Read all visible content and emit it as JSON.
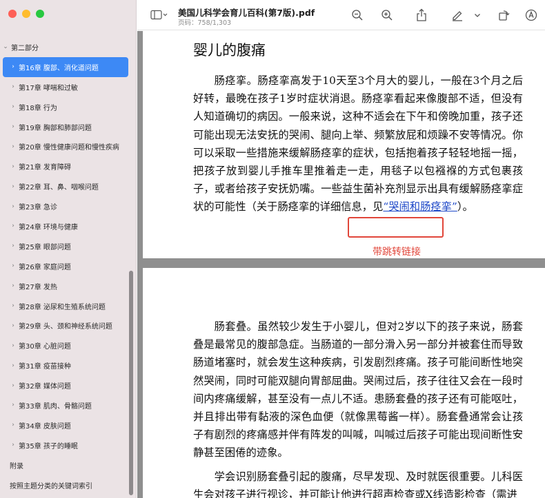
{
  "window": {
    "doc_title": "美国儿科学会育儿百科(第7版).pdf",
    "page_info": "页码：758/1,303"
  },
  "toolbar": {
    "icons": [
      "sidebar-toggle-icon",
      "chevron-down-icon",
      "zoom-out-icon",
      "zoom-in-icon",
      "share-icon",
      "highlight-pen-icon",
      "chevron-down-icon",
      "rotate-icon",
      "markup-icon"
    ]
  },
  "sidebar": {
    "section": "第二部分",
    "chapters": [
      "第16章 腹部、消化道问题",
      "第17章 哮喘和过敏",
      "第18章 行为",
      "第19章 胸部和肺部问题",
      "第20章 慢性健康问题和慢性疾病",
      "第21章 发育障碍",
      "第22章 耳、鼻、咽喉问题",
      "第23章 急诊",
      "第24章 环境与健康",
      "第25章 眼部问题",
      "第26章 家庭问题",
      "第27章 发热",
      "第28章 泌尿和生殖系统问题",
      "第29章 头、颈和神经系统问题",
      "第30章 心脏问题",
      "第31章 疫苗接种",
      "第32章 媒体问题",
      "第33章 肌肉、骨骼问题",
      "第34章 皮肤问题",
      "第35章 孩子的睡眠"
    ],
    "appendix": "附录",
    "index": "按照主题分类的关键词索引"
  },
  "page1": {
    "heading": "婴儿的腹痛",
    "para_before_link": "肠痉挛。肠痉挛高发于10天至3个月大的婴儿，一般在3个月之后好转，最晚在孩子1岁时症状消退。肠痉挛看起来像腹部不适，但没有人知道确切的病因。一般来说，这种不适会在下午和傍晚加重，孩子还可能出现无法安抚的哭闹、腿向上举、频繁放屁和烦躁不安等情况。你可以采取一些措施来缓解肠痉挛的症状，包括抱着孩子轻轻地摇一摇，把孩子放到婴儿手推车里推着走一走，用毯子以包襁褓的方式包裹孩子，或者给孩子安抚奶嘴。一些益生菌补充剂显示出具有缓解肠痉挛症状的可能性（关于肠痉挛的详细信息，",
    "link_prefix": "见",
    "link_text": "“哭闹和肠痉挛”",
    "para_after_link": "）。",
    "callout": "带跳转链接"
  },
  "page2": {
    "para1": "肠套叠。虽然较少发生于小婴儿，但对2岁以下的孩子来说，肠套叠是最常见的腹部急症。当肠道的一部分滑入另一部分并被套住而导致肠道堵塞时，就会发生这种疾病，引发剧烈疼痛。孩子可能间断性地突然哭闹，同时可能双腿向胃部屈曲。哭闹过后，孩子往往又会在一段时间内疼痛缓解，甚至没有一点儿不适。患肠套叠的孩子还有可能呕吐，并且排出带有黏液的深色血便（就像黑莓酱一样）。肠套叠通常会让孩子有剧烈的疼痛感并伴有阵发的叫喊，叫喊过后孩子可能出现间断性安静甚至困倦的迹象。",
    "para2": "学会识别肠套叠引起的腹痛，尽早发现、及时就医很重要。儿科医生会对孩子进行视诊，并可能让他进行超声检查或X线造影检查（需进"
  },
  "colors": {
    "selection": "#3d89f5",
    "callout": "#e1463a",
    "link": "#1b46c7",
    "sidebar_bg": "#ebe3e5"
  }
}
